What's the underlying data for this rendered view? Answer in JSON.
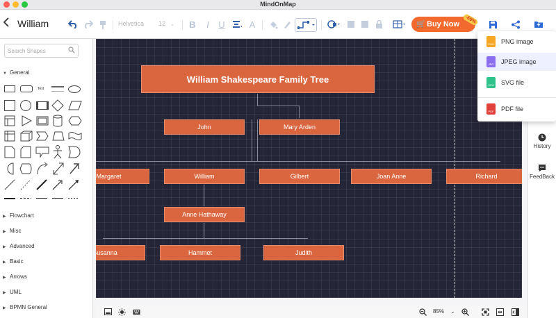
{
  "app": {
    "title": "MindOnMap"
  },
  "header": {
    "back_icon": "chevron-left-icon",
    "map_name": "William",
    "font_name": "Helvetica",
    "font_size": "12",
    "buy_label": "Buy Now",
    "discount_badge": "-69%",
    "accent": "#f26a2e"
  },
  "sidebar": {
    "search_placeholder": "Search Shapes",
    "general_label": "General",
    "text_shape_label": "Text",
    "categories": [
      "Flowchart",
      "Misc",
      "Advanced",
      "Basic",
      "Arrows",
      "UML",
      "BPMN General"
    ]
  },
  "canvas": {
    "background": "#252538",
    "node_color": "#d9663f",
    "nodes": {
      "root": "William Shakespeare Family Tree",
      "john": "John",
      "mary": "Mary Arden",
      "margaret": "Margaret",
      "william": "William",
      "gilbert": "Gilbert",
      "joan": "Joan Anne",
      "richard": "Richard",
      "anne": "Anne Hathaway",
      "susanna": "Susanna",
      "hammet": "Hammet",
      "judith": "Judith"
    }
  },
  "export_menu": {
    "items": [
      {
        "label": "PNG image",
        "icon": "png-file-icon",
        "color": "#f5a623",
        "tag": "PNG"
      },
      {
        "label": "JPEG image",
        "icon": "jpeg-file-icon",
        "color": "#8b6ef0",
        "tag": "JPG"
      },
      {
        "label": "SVG file",
        "icon": "svg-file-icon",
        "color": "#2fc28a",
        "tag": "SVG"
      },
      {
        "label": "PDF file",
        "icon": "pdf-file-icon",
        "color": "#e0403a",
        "tag": "PDF"
      }
    ],
    "selected": "JPEG image"
  },
  "right_panel": {
    "history_label": "History",
    "feedback_label": "FeedBack"
  },
  "status": {
    "zoom": "85%"
  }
}
